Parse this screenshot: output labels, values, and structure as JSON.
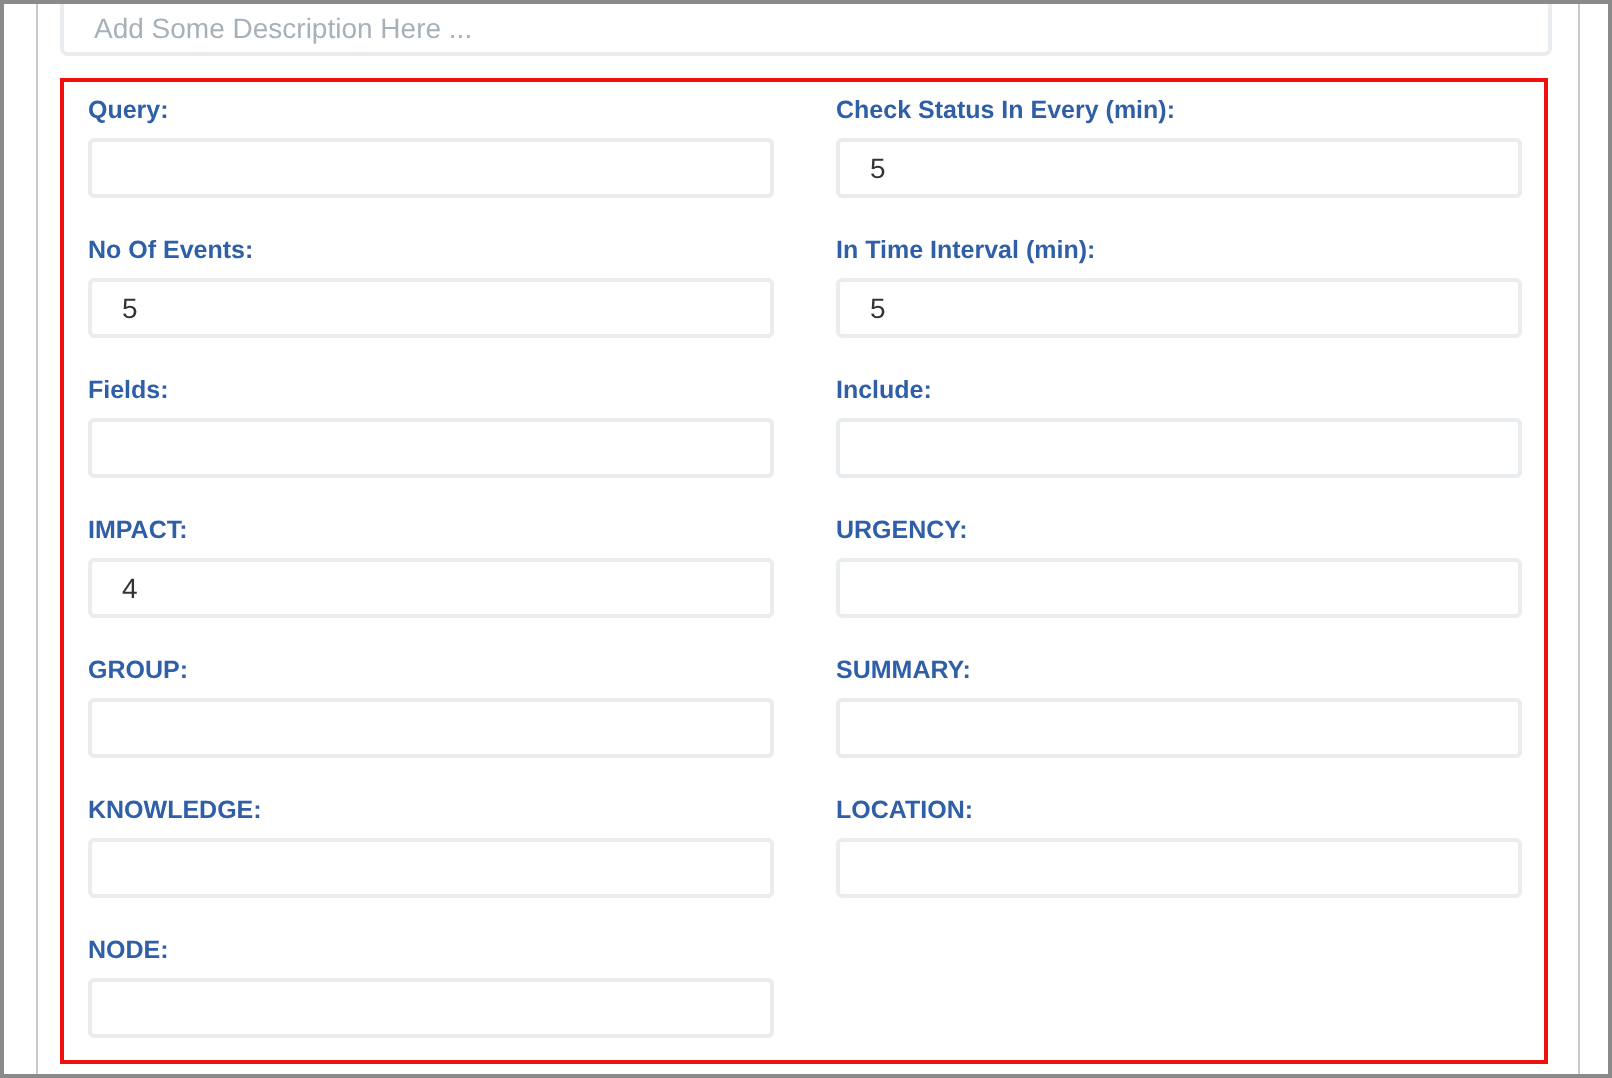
{
  "description": {
    "placeholder": "Add Some Description Here ..."
  },
  "fields": [
    {
      "label": "Query:"
    },
    {
      "label": "Check Status In Every (min):",
      "value": "5"
    },
    {
      "label": "No Of Events:",
      "value": "5"
    },
    {
      "label": "In Time Interval (min):",
      "value": "5"
    },
    {
      "label": "Fields:"
    },
    {
      "label": "Include:"
    },
    {
      "label": "IMPACT:",
      "value": "4"
    },
    {
      "label": "URGENCY:"
    },
    {
      "label": "GROUP:"
    },
    {
      "label": "SUMMARY:"
    },
    {
      "label": "KNOWLEDGE:"
    },
    {
      "label": "LOCATION:"
    },
    {
      "label": "NODE:"
    }
  ]
}
